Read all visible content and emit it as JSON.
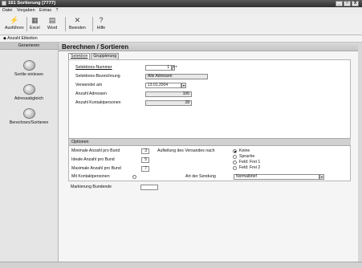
{
  "window": {
    "title": "161 Sortierung [7777]",
    "controls": [
      "_",
      "□",
      "X"
    ]
  },
  "menu": [
    "Datei",
    "Vorgaben",
    "Extras",
    "?"
  ],
  "toolbar": [
    {
      "label": "Ausführen",
      "icon": "run-icon"
    },
    {
      "label": "Excel",
      "icon": "excel-icon"
    },
    {
      "label": "Word",
      "icon": "word-icon"
    },
    {
      "label": "Beenden",
      "icon": "close-icon"
    },
    {
      "label": "Hilfe",
      "icon": "help-icon"
    }
  ],
  "subbar": {
    "label": "Anzahl Etiketten"
  },
  "sidebar": {
    "header": "Generieren",
    "items": [
      {
        "label": "Sortlie einlesen"
      },
      {
        "label": "Adressabgleich"
      },
      {
        "label": "Berechnen/Sortieren"
      }
    ]
  },
  "page": {
    "title": "Berechnen / Sortieren",
    "tabs": [
      "Selektion",
      "Gruppierung"
    ]
  },
  "selektion": {
    "nummer_label": "Selektions-Nummer",
    "nummer_value": "1",
    "bezeichnung_label": "Selektions-Bezeichnung",
    "bezeichnung_value": "Alle Adressen",
    "verwendet_label": "Verwendet am",
    "verwendet_value": "13.01.2004",
    "anzahl_adressen_label": "Anzahl Adressen",
    "anzahl_adressen_value": "106",
    "anzahl_kontakt_label": "Anzahl Kontaktpersonen",
    "anzahl_kontakt_value": "28"
  },
  "optionen": {
    "section_title": "Optionen",
    "min_label": "Minimale Anzahl pro Bund",
    "min_value": "3",
    "ideal_label": "Ideale Anzahl pro Bund",
    "ideal_value": "5",
    "max_label": "Maximale Anzahl pro Bund",
    "max_value": "7",
    "kontakt_label": "Mit Kontaktpersonen",
    "markierung_label": "Markierung Bundende",
    "markierung_value": "",
    "aufteilung_label": "Aufteilung des Versandes nach",
    "aufteilung_options": [
      "Keine",
      "Sprache",
      "Feld: Frei 1",
      "Feld: Frei 2"
    ],
    "art_label": "Art der Sendung",
    "art_value": "Normalbrief"
  }
}
